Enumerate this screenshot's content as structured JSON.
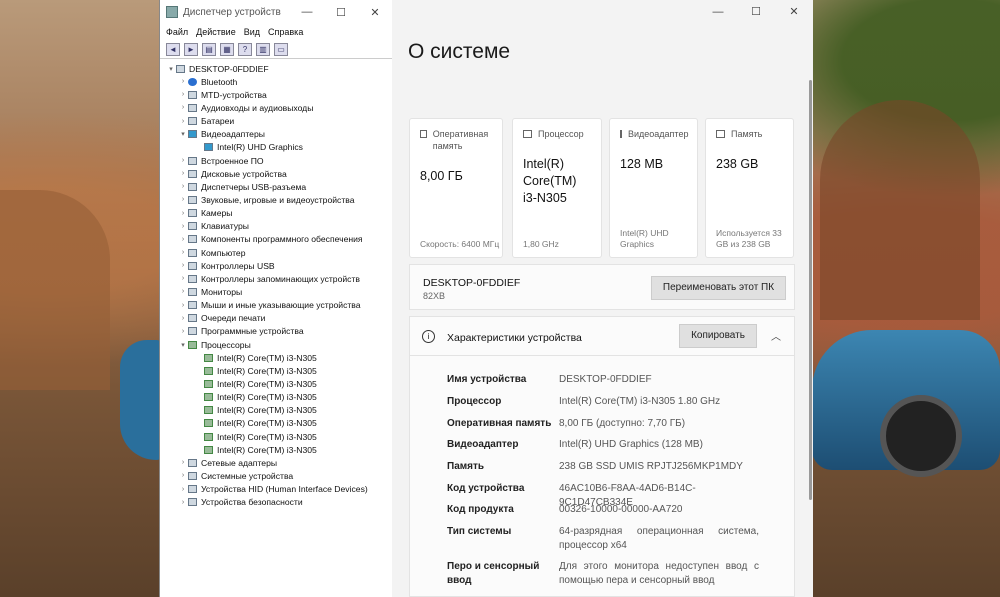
{
  "device_manager": {
    "title": "Диспетчер устройств",
    "menu": [
      "Файл",
      "Действие",
      "Вид",
      "Справка"
    ],
    "toolbar_icons": [
      "back-icon",
      "forward-icon",
      "properties-icon",
      "view-icon",
      "help-icon",
      "view2-icon",
      "monitor-icon"
    ],
    "root": "DESKTOP-0FDDIEF",
    "categories": [
      {
        "label": "Bluetooth",
        "icon": "bluetooth-icon"
      },
      {
        "label": "MTD-устройства",
        "icon": "device-icon"
      },
      {
        "label": "Аудиовходы и аудиовыходы",
        "icon": "audio-icon"
      },
      {
        "label": "Батареи",
        "icon": "battery-icon"
      },
      {
        "label": "Видеоадаптеры",
        "icon": "display-adapter-icon",
        "expanded": true,
        "children": [
          "Intel(R) UHD Graphics"
        ]
      },
      {
        "label": "Встроенное ПО",
        "icon": "firmware-icon"
      },
      {
        "label": "Дисковые устройства",
        "icon": "disk-icon"
      },
      {
        "label": "Диспетчеры USB-разъема",
        "icon": "usb-icon"
      },
      {
        "label": "Звуковые, игровые и видеоустройства",
        "icon": "sound-icon"
      },
      {
        "label": "Камеры",
        "icon": "camera-icon"
      },
      {
        "label": "Клавиатуры",
        "icon": "keyboard-icon"
      },
      {
        "label": "Компоненты программного обеспечения",
        "icon": "software-icon"
      },
      {
        "label": "Компьютер",
        "icon": "computer-icon"
      },
      {
        "label": "Контроллеры USB",
        "icon": "usb-controller-icon"
      },
      {
        "label": "Контроллеры запоминающих устройств",
        "icon": "storage-icon"
      },
      {
        "label": "Мониторы",
        "icon": "monitor-icon"
      },
      {
        "label": "Мыши и иные указывающие устройства",
        "icon": "mouse-icon"
      },
      {
        "label": "Очереди печати",
        "icon": "printer-icon"
      },
      {
        "label": "Программные устройства",
        "icon": "software-device-icon"
      },
      {
        "label": "Процессоры",
        "icon": "processor-icon",
        "expanded": true,
        "children": [
          "Intel(R) Core(TM) i3-N305",
          "Intel(R) Core(TM) i3-N305",
          "Intel(R) Core(TM) i3-N305",
          "Intel(R) Core(TM) i3-N305",
          "Intel(R) Core(TM) i3-N305",
          "Intel(R) Core(TM) i3-N305",
          "Intel(R) Core(TM) i3-N305",
          "Intel(R) Core(TM) i3-N305"
        ]
      },
      {
        "label": "Сетевые адаптеры",
        "icon": "network-icon"
      },
      {
        "label": "Системные устройства",
        "icon": "system-icon"
      },
      {
        "label": "Устройства HID (Human Interface Devices)",
        "icon": "hid-icon"
      },
      {
        "label": "Устройства безопасности",
        "icon": "security-icon"
      }
    ]
  },
  "settings": {
    "page_title": "О системе",
    "cards": [
      {
        "name": "ram",
        "label": "Оперативная память",
        "value": "8,00 ГБ",
        "sub": "Скорость: 6400 МГц",
        "icon": "ram-icon"
      },
      {
        "name": "cpu",
        "label": "Процессор",
        "value": "Intel(R) Core(TM) i3-N305",
        "sub": "1,80 GHz",
        "icon": "cpu-icon"
      },
      {
        "name": "gpu",
        "label": "Видеоадаптер",
        "value": "128 MB",
        "sub": "Intel(R) UHD Graphics",
        "icon": "gpu-icon"
      },
      {
        "name": "storage",
        "label": "Память",
        "value": "238 GB",
        "sub": "Используется 33 GB из 238 GB",
        "icon": "storage-icon"
      }
    ],
    "pc_name": "DESKTOP-0FDDIEF",
    "pc_model": "82XB",
    "rename_button": "Переименовать этот ПК",
    "specs_title": "Характеристики устройства",
    "copy_button": "Копировать",
    "specs": [
      {
        "key": "Имя устройства",
        "value": "DESKTOP-0FDDIEF"
      },
      {
        "key": "Процессор",
        "value": "Intel(R) Core(TM) i3-N305   1.80 GHz"
      },
      {
        "key": "Оперативная память",
        "value": "8,00 ГБ (доступно: 7,70 ГБ)"
      },
      {
        "key": "Видеоадаптер",
        "value": "Intel(R) UHD Graphics (128 MB)"
      },
      {
        "key": "Память",
        "value": "238 GB SSD UMIS RPJTJ256MKP1MDY"
      },
      {
        "key": "Код устройства",
        "value": "46AC10B6-F8AA-4AD6-B14C-9C1D47CB334E"
      },
      {
        "key": "Код продукта",
        "value": "00326-10000-00000-AA720"
      },
      {
        "key": "Тип системы",
        "value": "64-разрядная операционная система, процессор x64"
      },
      {
        "key": "Перо и сенсорный ввод",
        "value": "Для этого монитора недоступен ввод с помощью пера и сенсорный ввод"
      }
    ]
  }
}
